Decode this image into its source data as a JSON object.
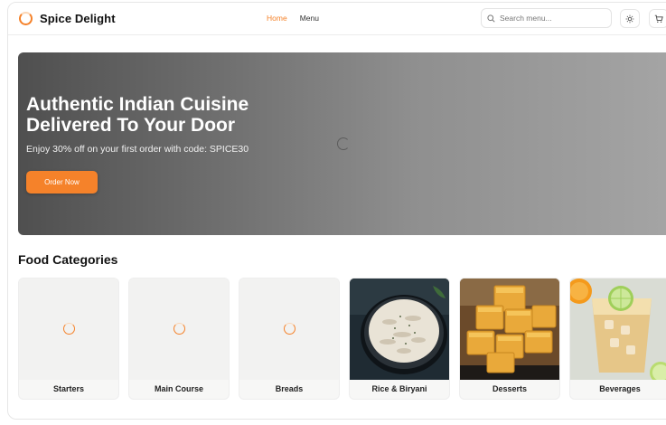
{
  "brand": {
    "name": "Spice Delight",
    "accent": "#f5822a"
  },
  "nav": {
    "home": "Home",
    "menu": "Menu"
  },
  "search": {
    "placeholder": "Search menu...",
    "value": ""
  },
  "header_icons": [
    "search-icon",
    "sun-icon",
    "cart-icon"
  ],
  "hero": {
    "title": "Authentic Indian Cuisine Delivered To Your Door",
    "subtitle": "Enjoy 30% off on your first order with code: SPICE30",
    "cta": "Order Now"
  },
  "categories": {
    "title": "Food Categories",
    "items": [
      {
        "label": "Starters",
        "state": "loading"
      },
      {
        "label": "Main Course",
        "state": "loading"
      },
      {
        "label": "Breads",
        "state": "loading"
      },
      {
        "label": "Rice & Biryani",
        "state": "image"
      },
      {
        "label": "Desserts",
        "state": "image"
      },
      {
        "label": "Beverages",
        "state": "image"
      }
    ]
  }
}
